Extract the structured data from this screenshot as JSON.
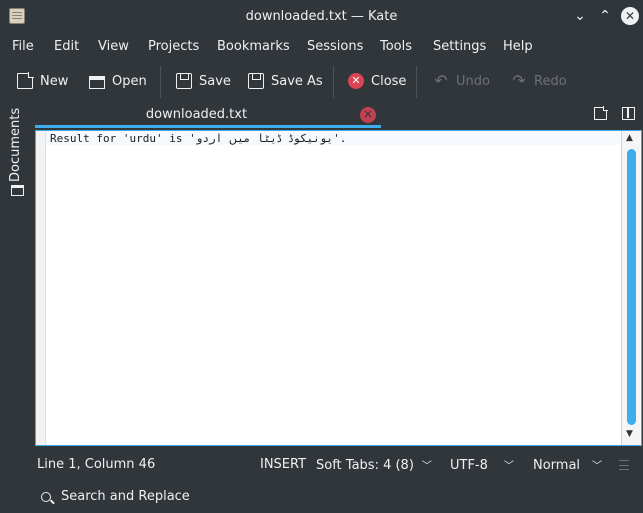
{
  "window": {
    "title": "downloaded.txt  — Kate",
    "controls": {
      "minimize": "⌄",
      "maximize": "⌃",
      "close": "✕"
    }
  },
  "menu": [
    "File",
    "Edit",
    "View",
    "Projects",
    "Bookmarks",
    "Sessions",
    "Tools",
    "Settings",
    "Help"
  ],
  "toolbar": {
    "new": "New",
    "open": "Open",
    "save": "Save",
    "save_as": "Save As",
    "close": "Close",
    "undo": "Undo",
    "redo": "Redo"
  },
  "sidebar": {
    "documents_label": "Documents"
  },
  "tab": {
    "label": "downloaded.txt",
    "close_glyph": "✕"
  },
  "editor": {
    "lines": [
      "Result for 'urdu' is 'یونیکوڈ ڈیٹا میں اردو'."
    ]
  },
  "statusbar": {
    "position": "Line 1, Column 46",
    "mode": "INSERT",
    "indent": "Soft Tabs: 4 (8)",
    "encoding": "UTF-8",
    "highlight": "Normal"
  },
  "bottombar": {
    "search_replace": "Search and Replace"
  },
  "colors": {
    "accent": "#3daee9",
    "danger": "#da4453",
    "background": "#31363b"
  },
  "icons": [
    "app-icon",
    "new-document-icon",
    "open-folder-icon",
    "save-icon",
    "save-as-icon",
    "close-icon",
    "undo-icon",
    "redo-icon",
    "folder-icon",
    "split-view-icon",
    "tab-close-icon",
    "search-icon"
  ]
}
